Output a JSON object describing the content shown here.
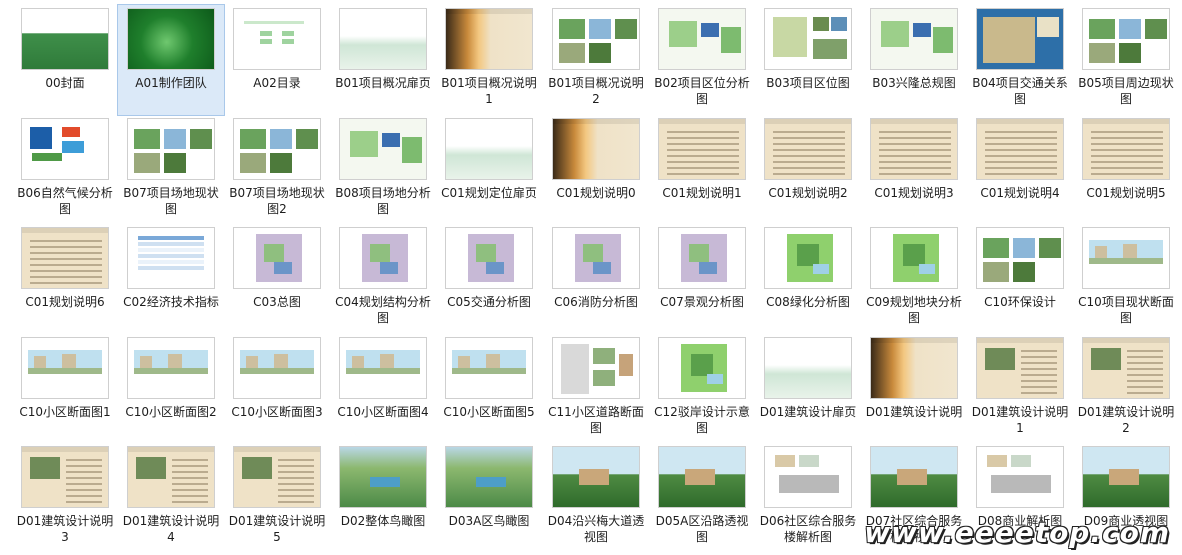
{
  "window": {
    "title": "",
    "view": "thumbnail-grid"
  },
  "selected_index": 1,
  "items": [
    {
      "label": "00封面",
      "style": "cover"
    },
    {
      "label": "A01制作团队",
      "style": "green"
    },
    {
      "label": "A02目录",
      "style": "toc"
    },
    {
      "label": "B01项目概况扉页",
      "style": "mist"
    },
    {
      "label": "B01项目概况说明1",
      "style": "sunset"
    },
    {
      "label": "B01项目概况说明2",
      "style": "photos"
    },
    {
      "label": "B02项目区位分析图",
      "style": "map-green"
    },
    {
      "label": "B03项目区位图",
      "style": "map-photos"
    },
    {
      "label": "B03兴隆总规图",
      "style": "map-green"
    },
    {
      "label": "B04项目交通关系图",
      "style": "map-blue"
    },
    {
      "label": "B05项目周边现状图",
      "style": "photos"
    },
    {
      "label": "B06自然气候分析图",
      "style": "globe"
    },
    {
      "label": "B07项目场地现状图",
      "style": "photos"
    },
    {
      "label": "B07项目场地现状图2",
      "style": "photos"
    },
    {
      "label": "B08项目场地分析图",
      "style": "map-green"
    },
    {
      "label": "C01规划定位扉页",
      "style": "mist"
    },
    {
      "label": "C01规划说明0",
      "style": "sunset"
    },
    {
      "label": "C01规划说明1",
      "style": "text"
    },
    {
      "label": "C01规划说明2",
      "style": "text"
    },
    {
      "label": "C01规划说明3",
      "style": "text"
    },
    {
      "label": "C01规划说明4",
      "style": "text"
    },
    {
      "label": "C01规划说明5",
      "style": "text"
    },
    {
      "label": "C01规划说明6",
      "style": "text"
    },
    {
      "label": "C02经济技术指标",
      "style": "table"
    },
    {
      "label": "C03总图",
      "style": "plan"
    },
    {
      "label": "C04规划结构分析图",
      "style": "plan"
    },
    {
      "label": "C05交通分析图",
      "style": "plan"
    },
    {
      "label": "C06消防分析图",
      "style": "plan"
    },
    {
      "label": "C07景观分析图",
      "style": "plan"
    },
    {
      "label": "C08绿化分析图",
      "style": "plan-green"
    },
    {
      "label": "C09规划地块分析图",
      "style": "plan-green"
    },
    {
      "label": "C10环保设计",
      "style": "photos"
    },
    {
      "label": "C10项目现状断面图",
      "style": "section"
    },
    {
      "label": "C10小区断面图1",
      "style": "section"
    },
    {
      "label": "C10小区断面图2",
      "style": "section"
    },
    {
      "label": "C10小区断面图3",
      "style": "section"
    },
    {
      "label": "C10小区断面图4",
      "style": "section"
    },
    {
      "label": "C10小区断面图5",
      "style": "section"
    },
    {
      "label": "C11小区道路断面图",
      "style": "road"
    },
    {
      "label": "C12驳岸设计示意图",
      "style": "plan-green"
    },
    {
      "label": "D01建筑设计扉页",
      "style": "mist"
    },
    {
      "label": "D01建筑设计说明",
      "style": "sunset"
    },
    {
      "label": "D01建筑设计说明1",
      "style": "text-photo"
    },
    {
      "label": "D01建筑设计说明2",
      "style": "text-photo"
    },
    {
      "label": "D01建筑设计说明3",
      "style": "text-photo"
    },
    {
      "label": "D01建筑设计说明4",
      "style": "text-photo"
    },
    {
      "label": "D01建筑设计说明5",
      "style": "text-photo"
    },
    {
      "label": "D02整体鸟瞰图",
      "style": "aerial"
    },
    {
      "label": "D03A区鸟瞰图",
      "style": "aerial"
    },
    {
      "label": "D04沿兴梅大道透视图",
      "style": "render"
    },
    {
      "label": "D05A区沿路透视图",
      "style": "render"
    },
    {
      "label": "D06社区综合服务楼解析图",
      "style": "drawing"
    },
    {
      "label": "D07社区综合服务楼透视图",
      "style": "render"
    },
    {
      "label": "D08商业解析图",
      "style": "drawing"
    },
    {
      "label": "D09商业透视图",
      "style": "render"
    }
  ],
  "watermark": "www.eeeetop.com",
  "palette": {
    "selected_bg": "#dbe9f8",
    "parchment": "#efe2c7",
    "green": "#2e8b3a",
    "sky": "#bfe0ef"
  }
}
